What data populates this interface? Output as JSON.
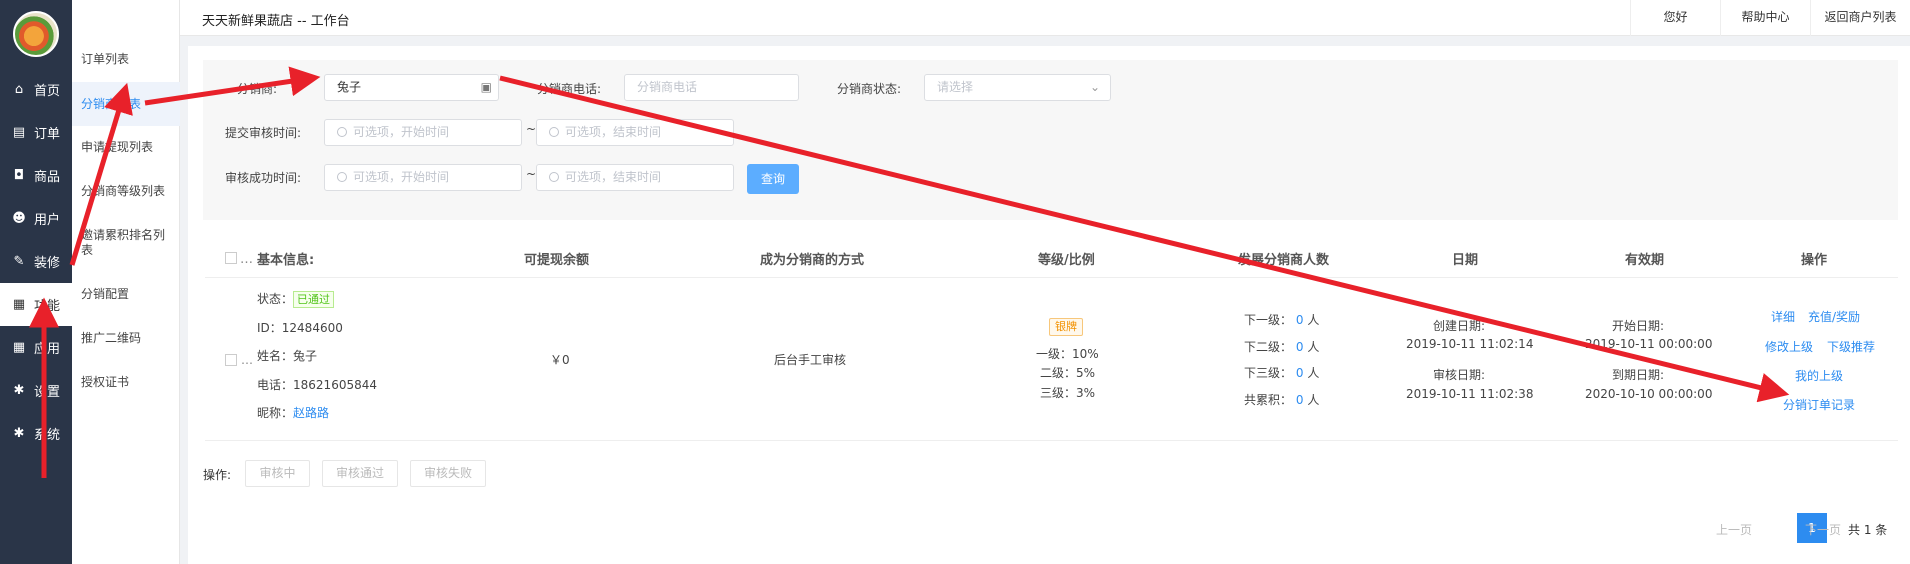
{
  "sidebar": {
    "items": [
      {
        "label": "首页",
        "icon": "home-icon"
      },
      {
        "label": "订单",
        "icon": "clipboard-icon"
      },
      {
        "label": "商品",
        "icon": "shopping-bag-icon"
      },
      {
        "label": "用户",
        "icon": "user-icon"
      },
      {
        "label": "装修",
        "icon": "brush-icon"
      },
      {
        "label": "功能",
        "icon": "grid-icon"
      },
      {
        "label": "应用",
        "icon": "grid-icon"
      },
      {
        "label": "设置",
        "icon": "gear-icon"
      },
      {
        "label": "系统",
        "icon": "gear-icon"
      }
    ]
  },
  "subnav": {
    "items": [
      "订单列表",
      "分销商列表",
      "申请提现列表",
      "分销商等级列表",
      "邀请累积排名列表",
      "分销配置",
      "推广二维码",
      "授权证书"
    ]
  },
  "topbar": {
    "title": "天天新鲜果蔬店  --  工作台",
    "hello": "您好",
    "help": "帮助中心",
    "back": "返回商户列表"
  },
  "filter": {
    "name_label": "分销商:",
    "name_value": "兔子",
    "phone_label": "分销商电话:",
    "phone_placeholder": "分销商电话",
    "status_label": "分销商状态:",
    "status_placeholder": "请选择",
    "submit_label": "提交审核时间:",
    "success_label": "审核成功时间:",
    "start_placeholder": "可选项，开始时间",
    "end_placeholder": "可选项，结束时间",
    "tilde": "~",
    "query": "查询"
  },
  "table": {
    "headers": {
      "basic": "基本信息:",
      "balance": "可提现余额",
      "method": "成为分销商的方式",
      "level": "等级/比例",
      "subs": "发展分销商人数",
      "date": "日期",
      "validity": "有效期",
      "ops": "操作"
    },
    "row": {
      "status_label": "状态：",
      "status_value": "已通过",
      "id_label": "ID：",
      "id_value": "12484600",
      "name_label": "姓名：",
      "name_value": "兔子",
      "phone_label": "电话：",
      "phone_value": "18621605844",
      "nick_label": "昵称：",
      "nick_value": "赵路路",
      "balance": "￥0",
      "method": "后台手工审核",
      "level_badge": "银牌",
      "level1": "一级：10%",
      "level2": "二级：5%",
      "level3": "三级：3%",
      "sub1_label": "下一级：",
      "sub2_label": "下二级：",
      "sub3_label": "下三级：",
      "subtotal_label": "共累积：",
      "sub_count": "0",
      "sub_unit": "人",
      "created_label": "创建日期:",
      "created_value": "2019-10-11 11:02:14",
      "audit_label": "审核日期:",
      "audit_value": "2019-10-11 11:02:38",
      "start_label": "开始日期:",
      "start_value": "2019-10-11 00:00:00",
      "expire_label": "到期日期:",
      "expire_value": "2020-10-10 00:00:00",
      "op_detail": "详细",
      "op_recharge": "充值/奖励",
      "op_modify_parent": "修改上级",
      "op_sub_recommend": "下级推荐",
      "op_my_parent": "我的上级",
      "op_orders": "分销订单记录"
    }
  },
  "bulk": {
    "label": "操作:",
    "btn1": "审核中",
    "btn2": "审核通过",
    "btn3": "审核失败"
  },
  "pager": {
    "prev": "上一页",
    "current": "1",
    "next": "下一页",
    "total": "共 1 条"
  },
  "colors": {
    "sidebar_bg": "#2a3548",
    "accent": "#2d8cf0",
    "arrow": "#e8212a"
  }
}
